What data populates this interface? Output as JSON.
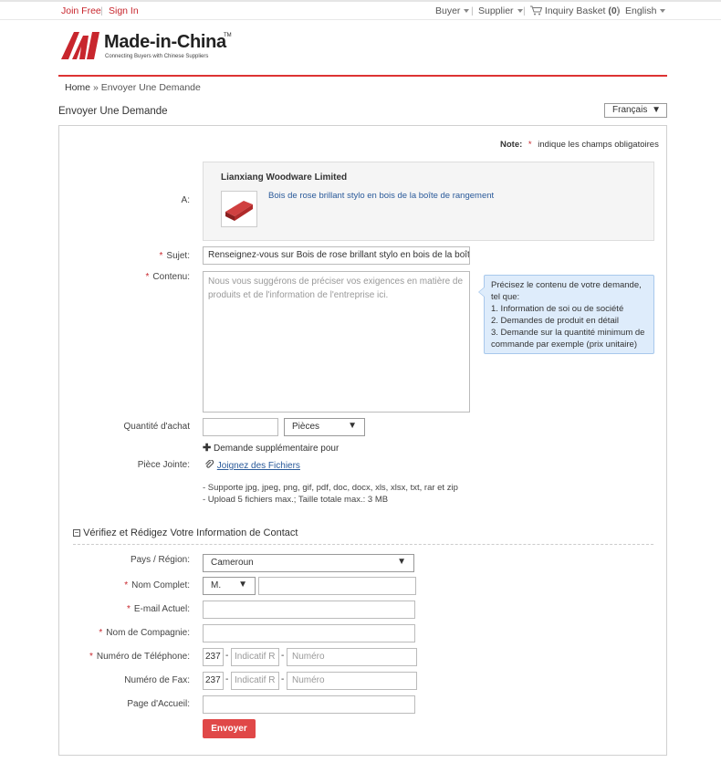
{
  "topbar": {
    "join_free": "Join Free",
    "sign_in": "Sign In",
    "buyer": "Buyer",
    "supplier": "Supplier",
    "inquiry_basket": "Inquiry Basket",
    "basket_count": "(0)",
    "language": "English"
  },
  "logo": {
    "name": "Made-in-China",
    "tm": "TM",
    "tagline": "Connecting Buyers with Chinese Suppliers"
  },
  "breadcrumb": {
    "home": "Home",
    "separator": "»",
    "current": "Envoyer Une Demande"
  },
  "page_title": "Envoyer Une Demande",
  "language_select": "Français",
  "note": {
    "label": "Note:",
    "star": "*",
    "text": "indique les champs obligatoires"
  },
  "form": {
    "to_label": "A:",
    "supplier_name": "Lianxiang Woodware Limited",
    "product_name": "Bois de rose brillant stylo en bois de la boîte de rangement",
    "subject_label": "Sujet:",
    "subject_value": "Renseignez-vous sur Bois de rose brillant stylo en bois de la boîte d",
    "content_label": "Contenu:",
    "content_placeholder": "Nous vous suggérons de préciser vos exigences en matière de produits et de l'information de l'entreprise ici.",
    "tip": {
      "line1": "Précisez le contenu de votre demande, tel que:",
      "line2": "1. Information de soi ou de société",
      "line3": "2. Demandes de produit en détail",
      "line4": "3. Demande sur la quantité minimum de commande par exemple (prix unitaire)"
    },
    "quantity_label": "Quantité d'achat",
    "quantity_unit": "Pièces",
    "extra_request": "Demande supplémentaire pour",
    "attachment_label": "Pièce Jointe:",
    "attach_link": "Joignez des Fichiers",
    "attach_note1": "- Supporte jpg, jpeg, png, gif, pdf, doc, docx, xls, xlsx, txt, rar et zip",
    "attach_note2": "- Upload 5 fichiers max.; Taille totale max.: 3 MB"
  },
  "contact": {
    "section_title": "Vérifiez et Rédigez Votre Information de Contact",
    "country_label": "Pays / Région:",
    "country_value": "Cameroun",
    "fullname_label": "Nom Complet:",
    "title_value": "M.",
    "email_label": "E-mail Actuel:",
    "company_label": "Nom de Compagnie:",
    "phone_label": "Numéro de Téléphone:",
    "fax_label": "Numéro de Fax:",
    "country_code": "237",
    "area_placeholder": "Indicatif R",
    "number_placeholder": "Numéro",
    "homepage_label": "Page d'Accueil:",
    "submit": "Envoyer"
  },
  "colors": {
    "brand_red": "#c8262d",
    "button_red": "#e04848",
    "link_blue": "#2a5a9a",
    "tip_bg": "#deecfb"
  }
}
